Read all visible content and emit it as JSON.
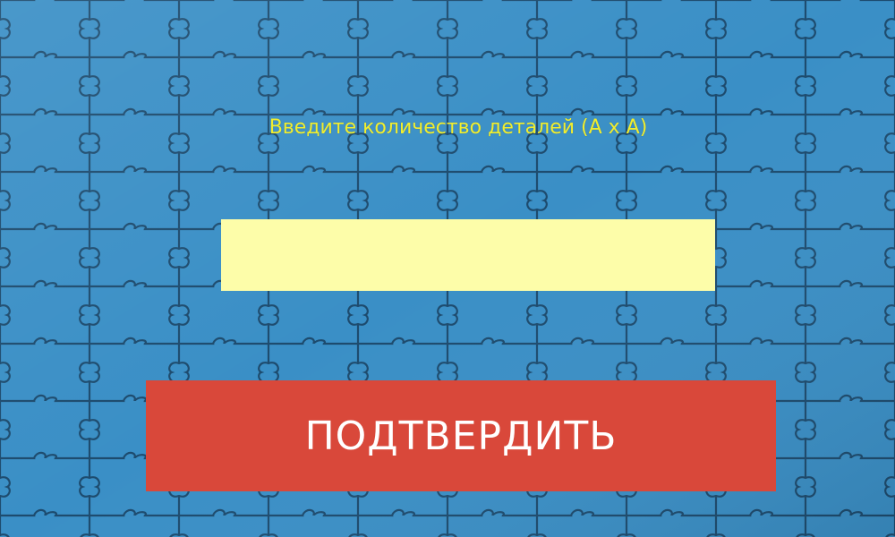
{
  "prompt": {
    "text": "Введите количество деталей (A x A)"
  },
  "count_input": {
    "value": "",
    "placeholder": ""
  },
  "confirm_button": {
    "label": "ПОДТВЕРДИТЬ"
  },
  "background": {
    "pattern": "jigsaw-puzzle-pieces"
  },
  "colors": {
    "background": "#3a8fc6",
    "puzzle_piece_line": "#1d4b6e",
    "prompt_text": "#f1ee2f",
    "input_background": "#fdfda9",
    "button_background": "#d9483a",
    "button_text": "#ffffff"
  }
}
